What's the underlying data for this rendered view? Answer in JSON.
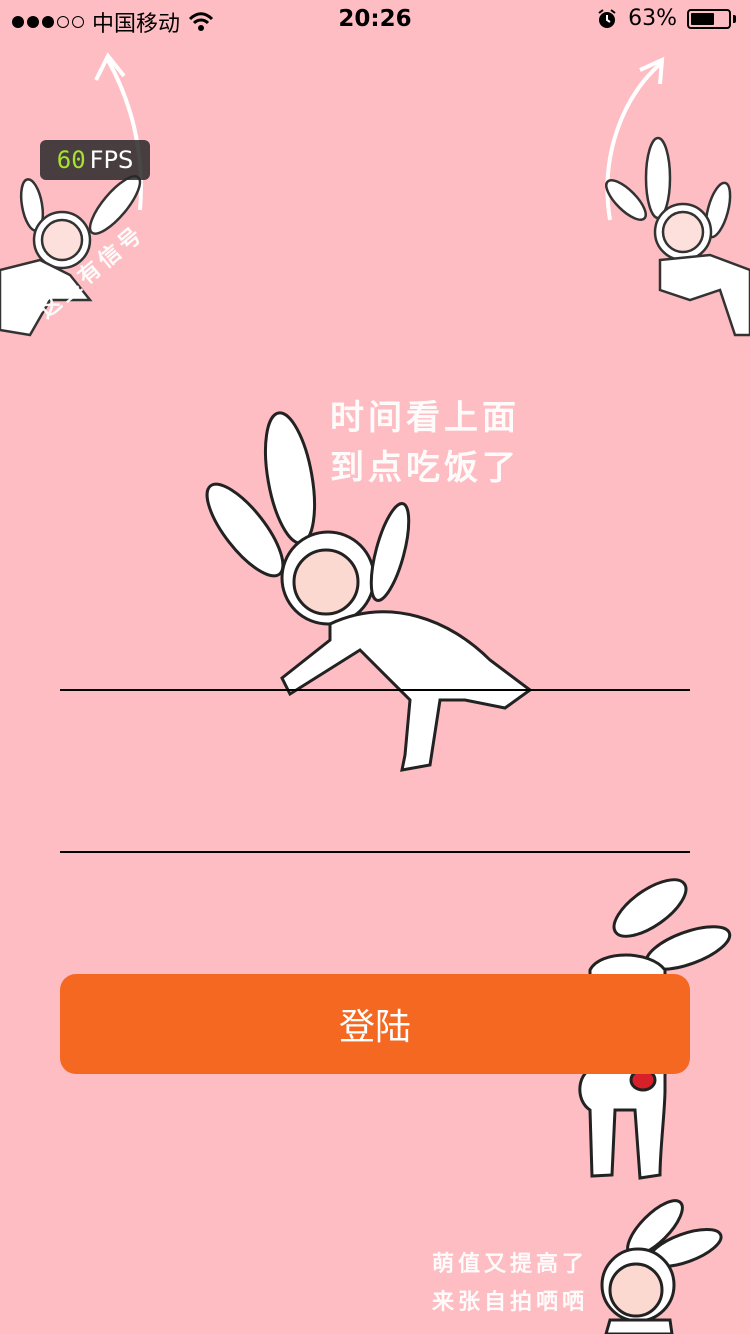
{
  "status_bar": {
    "carrier": "中国移动",
    "time": "20:26",
    "battery_percent": "63%",
    "battery_level": 0.63
  },
  "fps_overlay": {
    "value": "60",
    "label": "FPS"
  },
  "background_text": {
    "top_left_arc": "这里有信号",
    "center_line1": "时间看上面",
    "center_line2": "到点吃饭了",
    "bottom_right_line1": "萌值又提高了",
    "bottom_right_line2": "来张自拍哂哂"
  },
  "login_form": {
    "username_value": "",
    "password_value": "",
    "login_label": "登陆"
  },
  "colors": {
    "background": "#fdbdc3",
    "button": "#f56822"
  }
}
